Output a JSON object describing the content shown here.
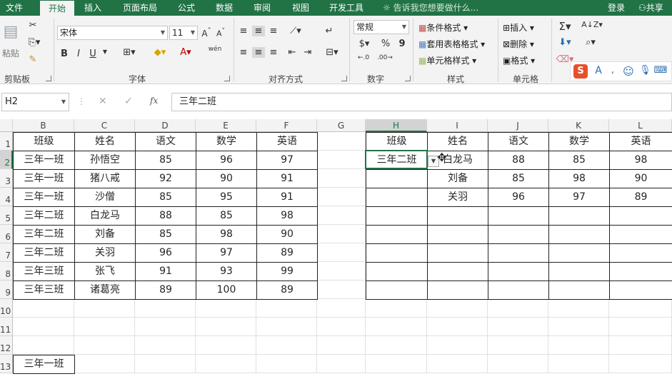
{
  "tabs": [
    "文件",
    "开始",
    "插入",
    "页面布局",
    "公式",
    "数据",
    "审阅",
    "视图",
    "开发工具"
  ],
  "active_tab": "开始",
  "search_hint": "告诉我您想要做什么...",
  "login": "登录",
  "share": "共享",
  "ribbon": {
    "clipboard": {
      "paste": "粘贴",
      "group": "剪贴板"
    },
    "font": {
      "name": "宋体",
      "size": "11",
      "group": "字体",
      "bold": "B",
      "italic": "I",
      "underline": "U",
      "phonetic": "wén"
    },
    "alignment": {
      "group": "对齐方式"
    },
    "number": {
      "format": "常规",
      "group": "数字",
      "percent": "%",
      "comma": "9"
    },
    "styles": {
      "conditional": "条件格式",
      "table": "套用表格格式",
      "cell": "单元格样式",
      "group": "样式"
    },
    "cells": {
      "insert": "插入",
      "delete": "删除",
      "format": "格式",
      "group": "单元格"
    }
  },
  "formula_bar": {
    "name_box": "H2",
    "fx": "fx",
    "content": "三年二班"
  },
  "columns": [
    "B",
    "C",
    "D",
    "E",
    "F",
    "G",
    "H",
    "I",
    "J",
    "K",
    "L"
  ],
  "selected_column": "H",
  "rows": [
    "1",
    "2",
    "3",
    "4",
    "5",
    "6",
    "7",
    "8",
    "9",
    "10",
    "11",
    "12",
    "13"
  ],
  "selected_row": "2",
  "source_table": {
    "headers": [
      "班级",
      "姓名",
      "语文",
      "数学",
      "英语"
    ],
    "rows": [
      [
        "三年一班",
        "孙悟空",
        "85",
        "96",
        "97"
      ],
      [
        "三年一班",
        "猪八戒",
        "92",
        "90",
        "91"
      ],
      [
        "三年一班",
        "沙僧",
        "85",
        "95",
        "91"
      ],
      [
        "三年二班",
        "白龙马",
        "88",
        "85",
        "98"
      ],
      [
        "三年二班",
        "刘备",
        "85",
        "98",
        "90"
      ],
      [
        "三年二班",
        "关羽",
        "96",
        "97",
        "89"
      ],
      [
        "三年三班",
        "张飞",
        "91",
        "93",
        "99"
      ],
      [
        "三年三班",
        "诸葛亮",
        "89",
        "100",
        "89"
      ]
    ]
  },
  "lookup_table": {
    "headers": [
      "班级",
      "姓名",
      "语文",
      "数学",
      "英语"
    ],
    "rows": [
      [
        "三年二班",
        "白龙马",
        "88",
        "85",
        "98"
      ],
      [
        "",
        "刘备",
        "85",
        "98",
        "90"
      ],
      [
        "",
        "关羽",
        "96",
        "97",
        "89"
      ],
      [
        "",
        "",
        "",
        "",
        ""
      ],
      [
        "",
        "",
        "",
        "",
        ""
      ],
      [
        "",
        "",
        "",
        "",
        ""
      ],
      [
        "",
        "",
        "",
        "",
        ""
      ],
      [
        "",
        "",
        "",
        "",
        ""
      ]
    ]
  },
  "b13": "三年一班",
  "colors": {
    "accent": "#217346"
  }
}
